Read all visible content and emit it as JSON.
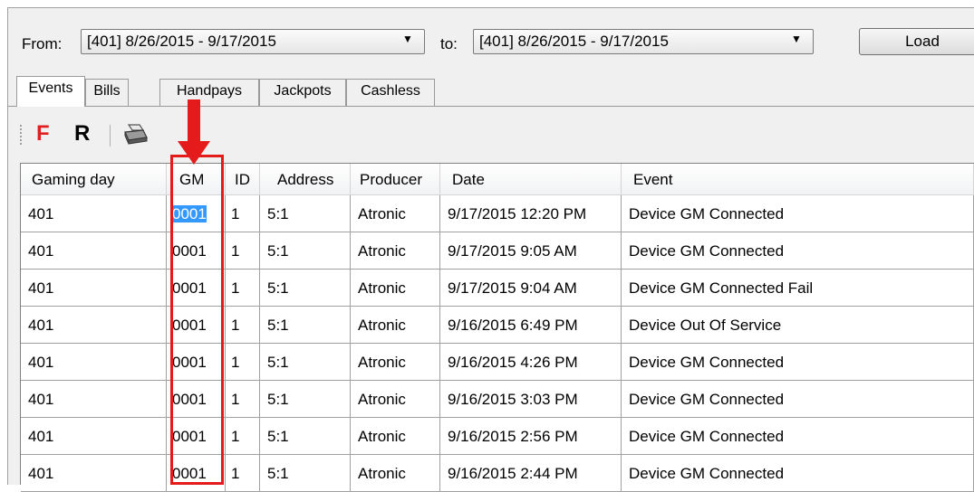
{
  "filter": {
    "from_label": "From:",
    "from_value": "[401] 8/26/2015 - 9/17/2015",
    "to_label": "to:",
    "to_value": "[401] 8/26/2015 - 9/17/2015",
    "load_label": "Load"
  },
  "tabs": [
    {
      "label": "Events",
      "active": true
    },
    {
      "label": "Bills",
      "active": false
    },
    {
      "label": "Handpays",
      "active": false
    },
    {
      "label": "Jackpots",
      "active": false
    },
    {
      "label": "Cashless",
      "active": false
    }
  ],
  "toolbar": {
    "f_label": "F",
    "r_label": "R",
    "f_color": "#e02020",
    "print_icon": "printer-icon"
  },
  "table": {
    "columns": [
      "Gaming day",
      "GM",
      "ID",
      "Address",
      "Producer",
      "Date",
      "Event"
    ],
    "rows": [
      {
        "gaming_day": "401",
        "gm": "0001",
        "id": "1",
        "address": "5:1",
        "producer": "Atronic",
        "date": "9/17/2015 12:20 PM",
        "event": "Device GM Connected"
      },
      {
        "gaming_day": "401",
        "gm": "0001",
        "id": "1",
        "address": "5:1",
        "producer": "Atronic",
        "date": "9/17/2015 9:05 AM",
        "event": "Device GM Connected"
      },
      {
        "gaming_day": "401",
        "gm": "0001",
        "id": "1",
        "address": "5:1",
        "producer": "Atronic",
        "date": "9/17/2015 9:04 AM",
        "event": "Device GM Connected Fail"
      },
      {
        "gaming_day": "401",
        "gm": "0001",
        "id": "1",
        "address": "5:1",
        "producer": "Atronic",
        "date": "9/16/2015 6:49 PM",
        "event": "Device Out Of Service"
      },
      {
        "gaming_day": "401",
        "gm": "0001",
        "id": "1",
        "address": "5:1",
        "producer": "Atronic",
        "date": "9/16/2015 4:26 PM",
        "event": "Device GM Connected"
      },
      {
        "gaming_day": "401",
        "gm": "0001",
        "id": "1",
        "address": "5:1",
        "producer": "Atronic",
        "date": "9/16/2015 3:03 PM",
        "event": "Device GM Connected"
      },
      {
        "gaming_day": "401",
        "gm": "0001",
        "id": "1",
        "address": "5:1",
        "producer": "Atronic",
        "date": "9/16/2015 2:56 PM",
        "event": "Device GM Connected"
      },
      {
        "gaming_day": "401",
        "gm": "0001",
        "id": "1",
        "address": "5:1",
        "producer": "Atronic",
        "date": "9/16/2015 2:44 PM",
        "event": "Device GM Connected"
      }
    ]
  },
  "annotation": {
    "color": "#e51b1b",
    "highlighted_column": "GM"
  },
  "colors": {
    "selection": "#3399ff",
    "background": "#f0f0f0"
  }
}
